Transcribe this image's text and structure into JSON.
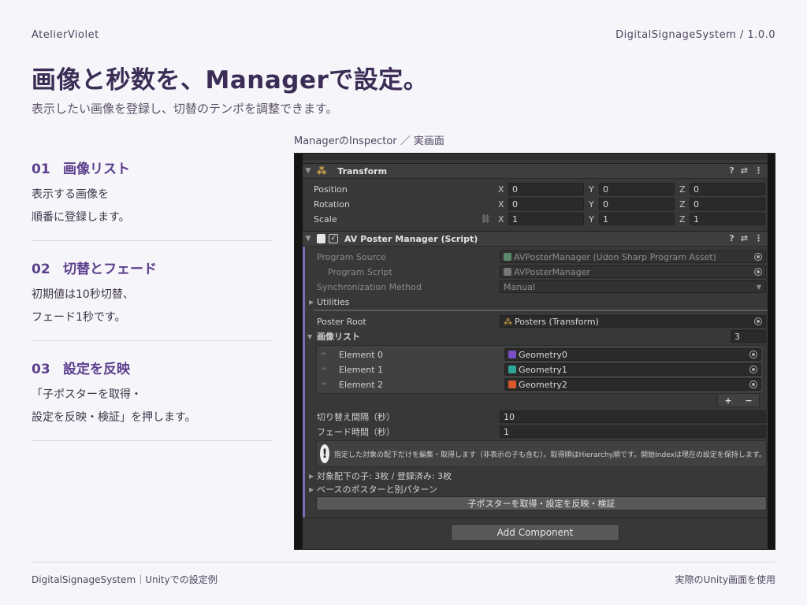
{
  "header": {
    "brand": "AtelierViolet",
    "version": "DigitalSignageSystem / 1.0.0",
    "title": "画像と秒数を、Managerで設定。",
    "subtitle": "表示したい画像を登録し、切替のテンポを調整できます。"
  },
  "steps": [
    {
      "num": "01",
      "heading": "画像リスト",
      "lines": [
        "表示する画像を",
        "順番に登録します。"
      ]
    },
    {
      "num": "02",
      "heading": "切替とフェード",
      "lines": [
        "初期値は10秒切替、",
        "フェード1秒です。"
      ]
    },
    {
      "num": "03",
      "heading": "設定を反映",
      "lines": [
        "「子ポスターを取得・",
        "設定を反映・検証」を押します。"
      ]
    }
  ],
  "caption": "ManagerのInspector ／ 実画面",
  "inspector": {
    "transform": {
      "title": "Transform",
      "rows": [
        {
          "label": "Position",
          "x": "0",
          "y": "0",
          "z": "0"
        },
        {
          "label": "Rotation",
          "x": "0",
          "y": "0",
          "z": "0"
        },
        {
          "label": "Scale",
          "x": "1",
          "y": "1",
          "z": "1"
        }
      ],
      "axes": {
        "x": "X",
        "y": "Y",
        "z": "Z"
      }
    },
    "script": {
      "title": "AV Poster Manager (Script)",
      "program_source_label": "Program Source",
      "program_source_value": "AVPosterManager (Udon Sharp Program Asset)",
      "program_script_label": "Program Script",
      "program_script_value": "AVPosterManager",
      "sync_label": "Synchronization Method",
      "sync_value": "Manual",
      "utilities_label": "Utilities",
      "poster_root_label": "Poster Root",
      "poster_root_value": "Posters (Transform)",
      "images_label": "画像リスト",
      "images_count": "3",
      "elements": [
        {
          "label": "Element 0",
          "value": "Geometry0",
          "color": "#7a4fc9"
        },
        {
          "label": "Element 1",
          "value": "Geometry1",
          "color": "#2fa59a"
        },
        {
          "label": "Element 2",
          "value": "Geometry2",
          "color": "#d9572b"
        }
      ],
      "plus": "+",
      "minus": "−",
      "interval_label": "切り替え間隔（秒）",
      "interval_value": "10",
      "fade_label": "フェード時間（秒）",
      "fade_value": "1",
      "help_text": "指定した対象の配下だけを編集・取得します（非表示の子も含む）。取得順はHierarchy順です。開始Indexは現在の設定を保持します。",
      "children_label": "対象配下の子: 3枚 / 登録済み: 3枚",
      "alt_pattern_label": "ベースのポスターと別パターン",
      "apply_button": "子ポスターを取得・設定を反映・検証",
      "add_component": "Add Component"
    }
  },
  "footer": {
    "left": "DigitalSignageSystem｜Unityでの設定例",
    "right": "実際のUnity画面を使用"
  }
}
